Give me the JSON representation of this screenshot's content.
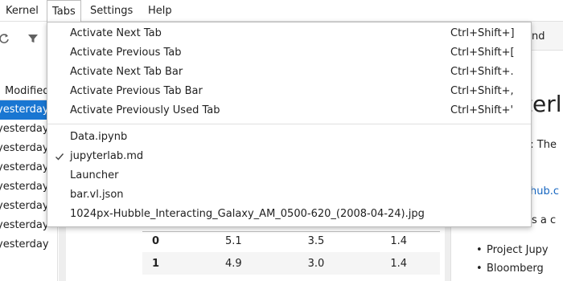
{
  "menubar": {
    "items": [
      {
        "label": "Kernel"
      },
      {
        "label": "Tabs"
      },
      {
        "label": "Settings"
      },
      {
        "label": "Help"
      }
    ]
  },
  "file_browser": {
    "column_header": "Modified",
    "rows": [
      "yesterday",
      "yesterday",
      "yesterday",
      "yesterday",
      "yesterday",
      "yesterday",
      "yesterday",
      "yesterday"
    ]
  },
  "notebook": {
    "table": [
      {
        "index": "0",
        "c1": "5.1",
        "c2": "3.5",
        "c3": "1.4"
      },
      {
        "index": "1",
        "c1": "4.9",
        "c2": "3.0",
        "c3": "1.4"
      }
    ]
  },
  "markdown_panel": {
    "tab_label": "nd",
    "heading": "terl",
    "text1": "b: The",
    "link": "hub.c",
    "text2": "as a c",
    "bullets": [
      "Project Jupy",
      "Bloomberg"
    ]
  },
  "tabs_menu": {
    "commands": [
      {
        "label": "Activate Next Tab",
        "shortcut": "Ctrl+Shift+]"
      },
      {
        "label": "Activate Previous Tab",
        "shortcut": "Ctrl+Shift+["
      },
      {
        "label": "Activate Next Tab Bar",
        "shortcut": "Ctrl+Shift+."
      },
      {
        "label": "Activate Previous Tab Bar",
        "shortcut": "Ctrl+Shift+,"
      },
      {
        "label": "Activate Previously Used Tab",
        "shortcut": "Ctrl+Shift+'"
      }
    ],
    "open_tabs": [
      {
        "label": "Data.ipynb",
        "checked": false
      },
      {
        "label": "jupyterlab.md",
        "checked": true
      },
      {
        "label": "Launcher",
        "checked": false
      },
      {
        "label": "bar.vl.json",
        "checked": false
      },
      {
        "label": "1024px-Hubble_Interacting_Galaxy_AM_0500-620_(2008-04-24).jpg",
        "checked": false
      }
    ]
  }
}
